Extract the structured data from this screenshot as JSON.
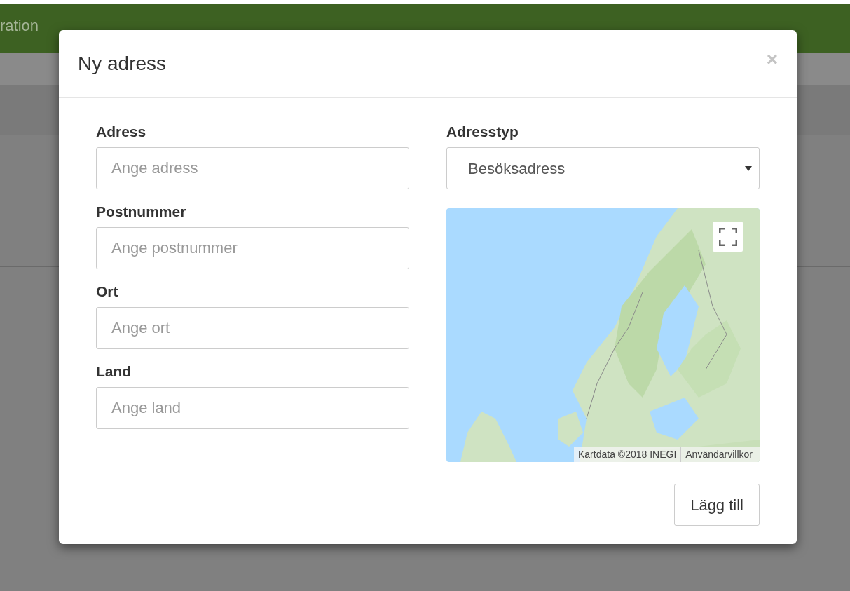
{
  "page": {
    "header_text": "ration"
  },
  "dialog": {
    "title": "Ny adress",
    "close": "×",
    "fields": [
      {
        "label": "Adress",
        "placeholder": "Ange adress"
      },
      {
        "label": "Postnummer",
        "placeholder": "Ange postnummer"
      },
      {
        "label": "Ort",
        "placeholder": "Ange ort"
      },
      {
        "label": "Land",
        "placeholder": "Ange land"
      }
    ],
    "address_type": {
      "label": "Adresstyp",
      "value": "Besöksadress"
    },
    "map": {
      "attribution": "Kartdata ©2018 INEGI",
      "terms": "Användarvillkor"
    },
    "submit": "Lägg till"
  }
}
